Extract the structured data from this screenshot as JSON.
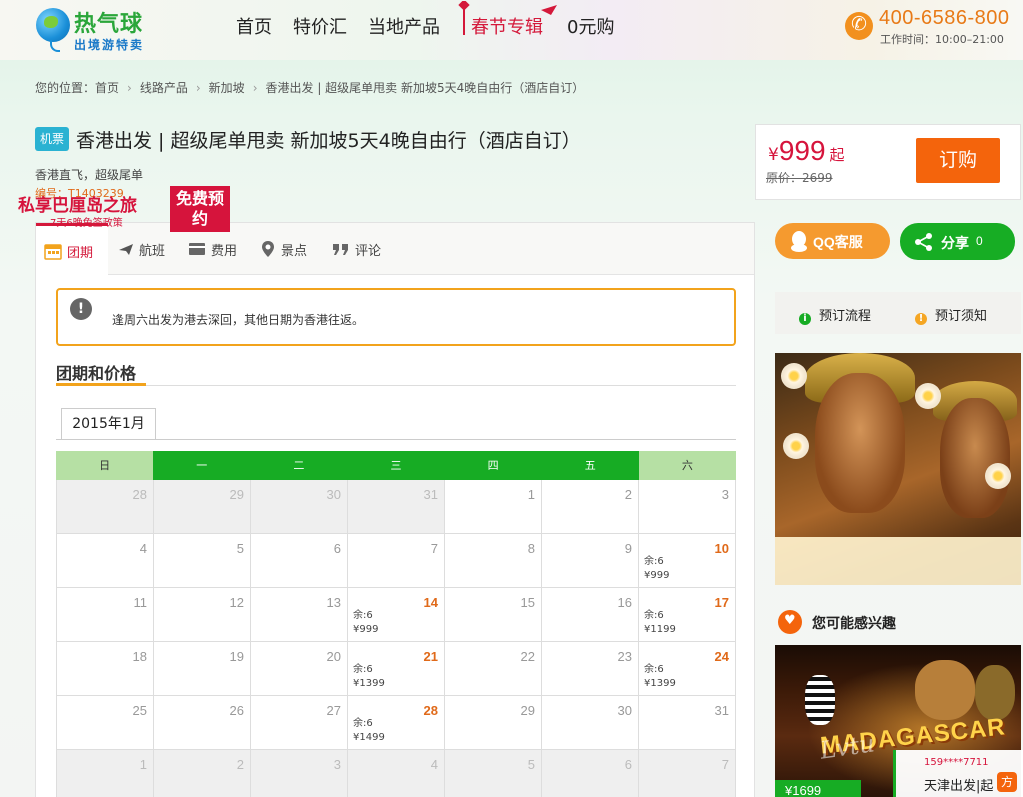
{
  "header": {
    "logo_title": "热气球",
    "logo_subtitle": "出境游特卖",
    "nav": [
      "首页",
      "特价汇",
      "当地产品"
    ],
    "nav_special": "春节专辑",
    "nav_last": "0元购",
    "phone": "400-6586-800",
    "work_hours": "工作时间：10:00–21:00"
  },
  "breadcrumb": {
    "label": "您的位置：",
    "items": [
      "首页",
      "线路产品",
      "新加坡",
      "香港出发 | 超级尾单甩卖 新加坡5天4晚自由行（酒店自订）"
    ]
  },
  "product": {
    "tag": "机票",
    "title": "香港出发 | 超级尾单甩卖 新加坡5天4晚自由行（酒店自订）",
    "subtitle": "香港直飞，超级尾单",
    "code_label": "编号：",
    "code": "T1403239"
  },
  "price": {
    "currency": "¥",
    "value": "999",
    "suffix": "起",
    "original": "原价：2699",
    "order_label": "订购"
  },
  "tabs": [
    "团期",
    "航班",
    "费用",
    "景点",
    "评论"
  ],
  "notice": "逢周六出发为港去深回，其他日期为香港往返。",
  "section_title": "团期和价格",
  "month": "2015年1月",
  "calendar": {
    "weekdays": [
      "日",
      "一",
      "二",
      "三",
      "四",
      "五",
      "六"
    ],
    "weeks": [
      [
        {
          "d": "28",
          "o": true
        },
        {
          "d": "29",
          "o": true
        },
        {
          "d": "30",
          "o": true
        },
        {
          "d": "31",
          "o": true
        },
        {
          "d": "1"
        },
        {
          "d": "2"
        },
        {
          "d": "3"
        }
      ],
      [
        {
          "d": "4"
        },
        {
          "d": "5"
        },
        {
          "d": "6"
        },
        {
          "d": "7"
        },
        {
          "d": "8"
        },
        {
          "d": "9"
        },
        {
          "d": "10",
          "s": "余:6",
          "p": "¥999"
        }
      ],
      [
        {
          "d": "11"
        },
        {
          "d": "12"
        },
        {
          "d": "13"
        },
        {
          "d": "14",
          "s": "余:6",
          "p": "¥999"
        },
        {
          "d": "15"
        },
        {
          "d": "16"
        },
        {
          "d": "17",
          "s": "余:6",
          "p": "¥1199"
        }
      ],
      [
        {
          "d": "18"
        },
        {
          "d": "19"
        },
        {
          "d": "20"
        },
        {
          "d": "21",
          "s": "余:6",
          "p": "¥1399"
        },
        {
          "d": "22"
        },
        {
          "d": "23"
        },
        {
          "d": "24",
          "s": "余:6",
          "p": "¥1399"
        }
      ],
      [
        {
          "d": "25"
        },
        {
          "d": "26"
        },
        {
          "d": "27"
        },
        {
          "d": "28",
          "s": "余:6",
          "p": "¥1499"
        },
        {
          "d": "29"
        },
        {
          "d": "30"
        },
        {
          "d": "31"
        }
      ],
      [
        {
          "d": "1",
          "o": true
        },
        {
          "d": "2",
          "o": true
        },
        {
          "d": "3",
          "o": true
        },
        {
          "d": "4",
          "o": true
        },
        {
          "d": "5",
          "o": true
        },
        {
          "d": "6",
          "o": true
        },
        {
          "d": "7",
          "o": true
        }
      ]
    ]
  },
  "sidebar": {
    "qq_label": "QQ客服",
    "share_label": "分享",
    "share_count": "0",
    "link1": "预订流程",
    "link2": "预订须知",
    "banner_title": "私享巴厘岛之旅",
    "banner_sub": "7天6晚免签政策",
    "banner_badge": "免费预约",
    "interest_title": "您可能感兴趣",
    "pic_sign": "MADAGASCAR",
    "price_tag": "¥1699",
    "popup_num": "159****7711",
    "popup_text": "天津出发|起",
    "popup_icon": "方",
    "watermark": "Lvtu"
  },
  "colors": {
    "accent": "#d4183a",
    "green": "#17ac24",
    "orange": "#f4640c"
  }
}
